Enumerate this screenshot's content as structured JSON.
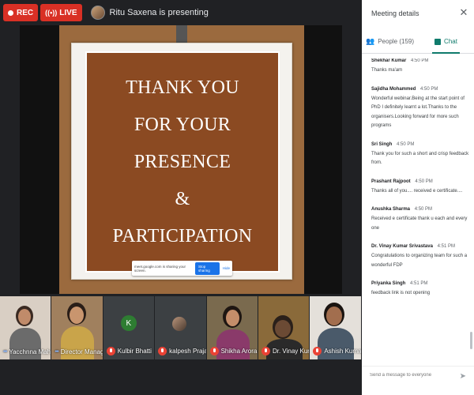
{
  "topbar": {
    "rec_label": "REC",
    "live_label": "LIVE",
    "presenting_text": "Ritu Saxena is presenting"
  },
  "slide": {
    "lines": [
      "THANK YOU",
      "FOR YOUR",
      "PRESENCE",
      "&",
      "PARTICIPATION"
    ]
  },
  "share_banner": {
    "text": "meet.google.com is sharing your screen.",
    "stop_label": "Stop sharing",
    "hide_label": "Hide"
  },
  "participants": [
    {
      "name": "Yacchnna Mah…",
      "muted": false
    },
    {
      "name": "Director Manag…",
      "muted": false
    },
    {
      "name": "Kulbir Bhatti",
      "muted": true,
      "initial": "K"
    },
    {
      "name": "kalpesh Prajap…",
      "muted": true
    },
    {
      "name": "Shikha Arora",
      "muted": true
    },
    {
      "name": "Dr. Vinay Kuma…",
      "muted": true
    },
    {
      "name": "Ashish Kumar…",
      "muted": true
    }
  ],
  "panel": {
    "title": "Meeting details",
    "people_tab": "People (159)",
    "chat_tab": "Chat",
    "composer_placeholder": "Send a message to everyone"
  },
  "messages": [
    {
      "sender": "Shekhar Kumar",
      "time": "4:50 PM",
      "text": "Thanks ma'am"
    },
    {
      "sender": "Sajidha Mohammed",
      "time": "4:50 PM",
      "text": "Wonderful webinar.Being at the start point of PhD I definitely learnt a lot.Thanks to the organisers.Looking forward for more such programs"
    },
    {
      "sender": "Sri Singh",
      "time": "4:50 PM",
      "text": "Thank you for such a short and crisp feedback from."
    },
    {
      "sender": "Prashant Rajpoot",
      "time": "4:50 PM",
      "text": "Thanks all of you.... received e certificate...."
    },
    {
      "sender": "Anushka Sharma",
      "time": "4:50 PM",
      "text": "Received e certificate thank u each and every one"
    },
    {
      "sender": "Dr. Vinay Kumar Srivastava",
      "time": "4:51 PM",
      "text": "Congratulations to organizing team for such a wonderful FDP"
    },
    {
      "sender": "Priyanka Singh",
      "time": "4:51 PM",
      "text": "feedback link is not opening"
    }
  ],
  "colors": {
    "rec": "#d93025",
    "chat_accent": "#0f7b6c",
    "slide_bg": "#8b4a22",
    "stop_button": "#1a73e8"
  },
  "icons": [
    "record-dot-icon",
    "live-broadcast-icon",
    "close-icon",
    "people-icon",
    "chat-icon",
    "mic-off-icon",
    "send-icon",
    "cursor-icon"
  ]
}
